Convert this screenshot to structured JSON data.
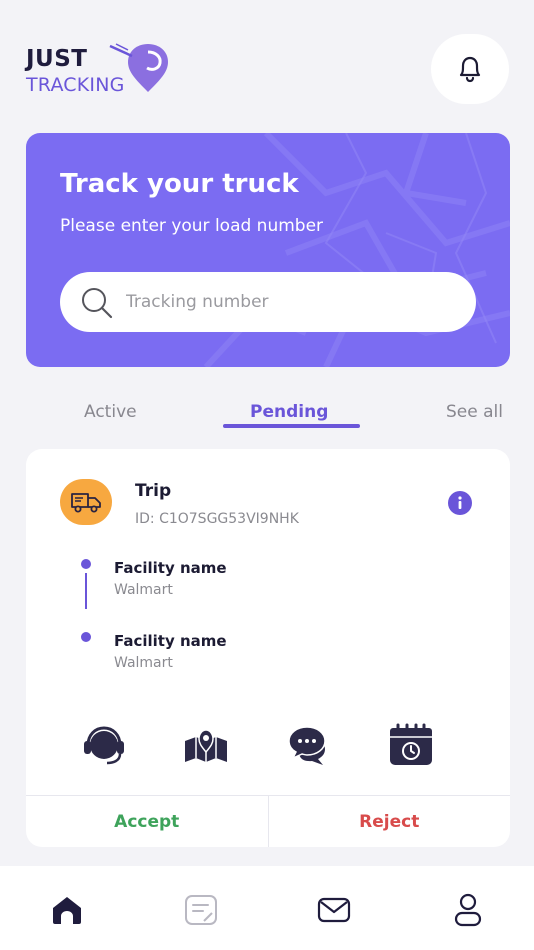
{
  "brand": {
    "line1": "JUST",
    "line2": "TRACKING",
    "logo_icon": "location-pin-swirl-icon"
  },
  "header": {
    "notification_icon": "bell-icon"
  },
  "hero": {
    "title": "Track your truck",
    "subtitle": "Please enter your load number",
    "search": {
      "placeholder": "Tracking number",
      "value": "",
      "icon": "search-icon"
    },
    "background": "#7b6cf2"
  },
  "tabs": {
    "items": [
      {
        "label": "Active",
        "active": false
      },
      {
        "label": "Pending",
        "active": true
      }
    ],
    "see_all": "See all"
  },
  "trip": {
    "icon": "truck-icon",
    "title": "Trip",
    "id_text": "ID: C1O7SGG53VI9NHK",
    "info_icon": "info-icon",
    "stops": [
      {
        "label": "Facility name",
        "value": "Walmart"
      },
      {
        "label": "Facility name",
        "value": "Walmart"
      }
    ],
    "actions": [
      "support-headset-icon",
      "map-icon",
      "chat-icon",
      "calendar-clock-icon"
    ],
    "accept_label": "Accept",
    "reject_label": "Reject"
  },
  "bottom_nav": {
    "items": [
      {
        "icon": "home-icon",
        "active": true
      },
      {
        "icon": "notes-icon",
        "active": false
      },
      {
        "icon": "mail-icon",
        "active": false
      },
      {
        "icon": "profile-icon",
        "active": false
      }
    ]
  },
  "colors": {
    "accent": "#6a55d9",
    "truck_badge": "#f7a840",
    "accept": "#3ea35b",
    "reject": "#d84b4b",
    "page_bg": "#f3f3f7"
  }
}
